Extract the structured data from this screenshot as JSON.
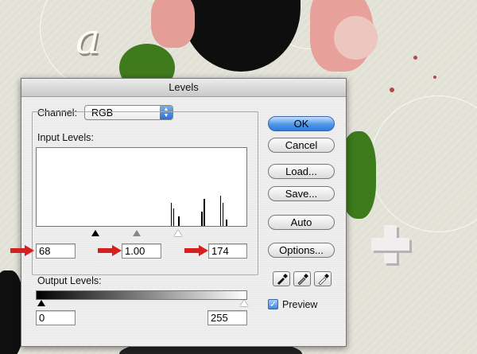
{
  "dialog": {
    "title": "Levels",
    "channel_label": "Channel:",
    "channel_value": "RGB",
    "input_levels_label": "Input Levels:",
    "input_black": "68",
    "input_gamma": "1.00",
    "input_white": "174",
    "output_levels_label": "Output Levels:",
    "output_black": "0",
    "output_white": "255",
    "preview_label": "Preview",
    "preview_checked": true
  },
  "buttons": {
    "ok": "OK",
    "cancel": "Cancel",
    "load": "Load...",
    "save": "Save...",
    "auto": "Auto",
    "options": "Options..."
  },
  "histogram": {
    "bars": [
      {
        "level": 163,
        "height": 0.3
      },
      {
        "level": 166,
        "height": 0.22
      },
      {
        "level": 172,
        "height": 0.12
      },
      {
        "level": 200,
        "height": 0.18
      },
      {
        "level": 203,
        "height": 0.35
      },
      {
        "level": 223,
        "height": 0.39
      },
      {
        "level": 226,
        "height": 0.3
      },
      {
        "level": 230,
        "height": 0.08
      }
    ]
  },
  "colors": {
    "accent": "#2f7ae0",
    "arrow": "#d62020"
  }
}
